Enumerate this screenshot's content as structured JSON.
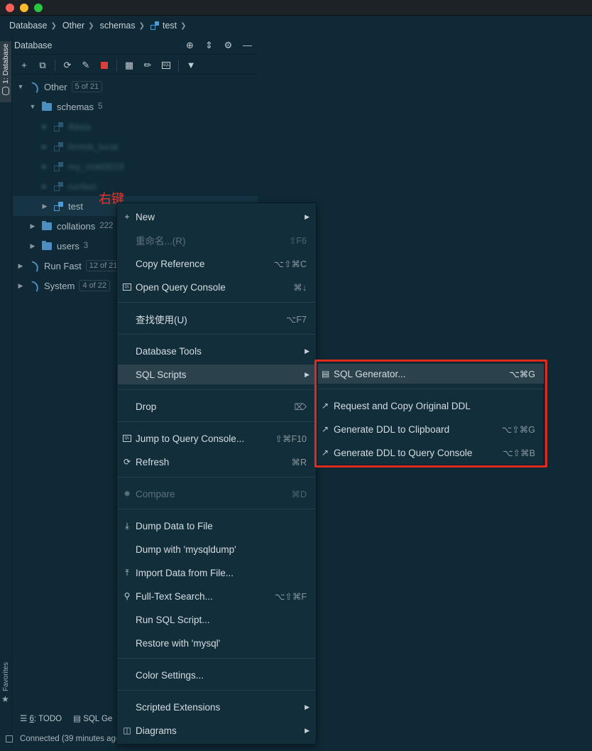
{
  "window": {
    "controls": [
      "close",
      "minimize",
      "zoom"
    ]
  },
  "breadcrumb": [
    "Database",
    "Other",
    "schemas",
    "test"
  ],
  "side_tabs": {
    "database": "1: Database",
    "favorites": "Favorites"
  },
  "panel": {
    "title": "Database",
    "header_icons": [
      "crosshair-icon",
      "collapse-icon",
      "gear-icon",
      "minimize-icon"
    ],
    "toolbar_icons": [
      "add-icon",
      "duplicate-icon",
      "refresh-icon",
      "properties-icon",
      "stop-icon",
      "table-icon",
      "edit-icon",
      "sql-console-icon",
      "filter-icon"
    ]
  },
  "tree": {
    "other": {
      "label": "Other",
      "count": "5 of 21"
    },
    "schemas": {
      "label": "schemas",
      "count": "5"
    },
    "blurred_items": [
      "ifdata",
      "brnlob_local",
      "my_rmkt0029",
      "runfast"
    ],
    "test": {
      "label": "test"
    },
    "collations": {
      "label": "collations",
      "count": "222"
    },
    "users": {
      "label": "users",
      "count": "3"
    },
    "runfast": {
      "label": "Run Fast",
      "count": "12 of 21"
    },
    "system": {
      "label": "System",
      "count": "4 of 22"
    }
  },
  "annotation": "右键",
  "context_menu": {
    "new": {
      "label": "New"
    },
    "rename": {
      "label": "重命名...(R)",
      "shortcut": "⇧F6"
    },
    "copy_reference": {
      "label": "Copy Reference",
      "shortcut": "⌥⇧⌘C"
    },
    "open_query_console": {
      "label": "Open Query Console",
      "shortcut": "⌘↓"
    },
    "find_usages": {
      "label": "查找使用(U)",
      "shortcut": "⌥F7"
    },
    "database_tools": {
      "label": "Database Tools"
    },
    "sql_scripts": {
      "label": "SQL Scripts"
    },
    "drop": {
      "label": "Drop"
    },
    "jump_console": {
      "label": "Jump to Query Console...",
      "shortcut": "⇧⌘F10"
    },
    "refresh": {
      "label": "Refresh",
      "shortcut": "⌘R"
    },
    "compare": {
      "label": "Compare",
      "shortcut": "⌘D"
    },
    "dump_data": {
      "label": "Dump Data to File"
    },
    "dump_mysqldump": {
      "label": "Dump with 'mysqldump'"
    },
    "import_data": {
      "label": "Import Data from File..."
    },
    "full_text_search": {
      "label": "Full-Text Search...",
      "shortcut": "⌥⇧⌘F"
    },
    "run_sql_script": {
      "label": "Run SQL Script..."
    },
    "restore_mysql": {
      "label": "Restore with 'mysql'"
    },
    "color_settings": {
      "label": "Color Settings..."
    },
    "scripted_extensions": {
      "label": "Scripted Extensions"
    },
    "diagrams": {
      "label": "Diagrams"
    }
  },
  "submenu": {
    "sql_generator": {
      "label": "SQL Generator...",
      "shortcut": "⌥⌘G"
    },
    "request_copy_ddl": {
      "label": "Request and Copy Original DDL"
    },
    "ddl_clipboard": {
      "label": "Generate DDL to Clipboard",
      "shortcut": "⌥⇧⌘G"
    },
    "ddl_console": {
      "label": "Generate DDL to Query Console",
      "shortcut": "⌥⇧⌘B"
    }
  },
  "bottom_tabs": {
    "todo_num": "6",
    "todo_label": ": TODO",
    "sql": "SQL Ge"
  },
  "status": "Connected (39 minutes ago",
  "colors": {
    "highlight_border": "#e02c1f",
    "background": "#0f2a36",
    "menu_hover": "#2b414c"
  }
}
